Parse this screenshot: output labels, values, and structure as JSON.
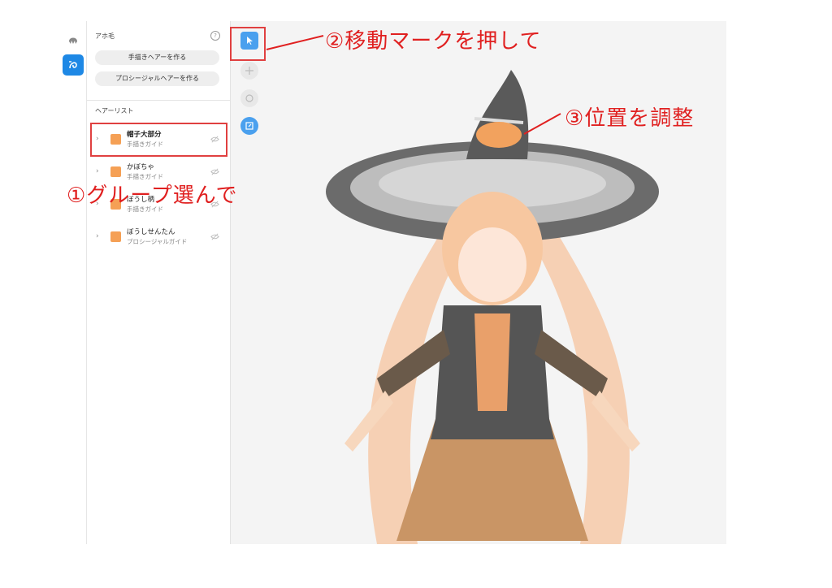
{
  "panel": {
    "section_title": "アホ毛",
    "help_label": "?",
    "btn_handdraw": "手描きヘアーを作る",
    "btn_procedural": "プロシージャルヘアーを作る",
    "list_title": "ヘアーリスト",
    "items": [
      {
        "name": "帽子大部分",
        "sub": "手描きガイド"
      },
      {
        "name": "かぼちゃ",
        "sub": "手描きガイド"
      },
      {
        "name": "ぼうし柄",
        "sub": "手描きガイド"
      },
      {
        "name": "ぼうしせんたん",
        "sub": "プロシージャルガイド"
      }
    ]
  },
  "annotations": {
    "step1": "①グループ選んで",
    "step2": "②移動マークを押して",
    "step3": "③位置を調整"
  },
  "colors": {
    "accent": "#1e88e5",
    "annotation_red": "#e02020",
    "swatch": "#f5a055"
  },
  "icons": {
    "hair_style": "hair-icon",
    "hair_edit": "hair-edit-icon",
    "select": "cursor-icon",
    "move": "move-icon",
    "rotate": "rotate-icon",
    "scale": "scale-icon",
    "visibility": "eye-off-icon",
    "expand": "chevron-right-icon"
  }
}
